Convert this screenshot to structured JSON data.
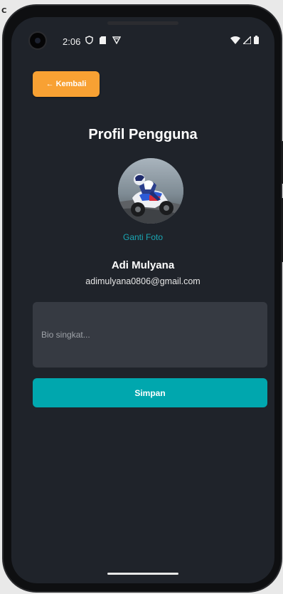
{
  "corner_text": "C",
  "status_bar": {
    "time": "2:06",
    "icons_left": [
      "shield-icon",
      "sd-card-icon",
      "vpn-icon"
    ],
    "icons_right": [
      "wifi-icon",
      "signal-icon",
      "battery-icon"
    ]
  },
  "header": {
    "back_label": "Kembali",
    "back_arrow": "←",
    "title": "Profil Pengguna"
  },
  "profile": {
    "change_photo_label": "Ganti Foto",
    "name": "Adi Mulyana",
    "email": "adimulyana0806@gmail.com"
  },
  "form": {
    "bio_placeholder": "Bio singkat...",
    "bio_value": "",
    "save_label": "Simpan"
  },
  "colors": {
    "background": "#1f232a",
    "back_button": "#f8a133",
    "accent_link": "#1aa6b3",
    "save_button": "#00a7ae",
    "input_bg": "#363a42"
  }
}
